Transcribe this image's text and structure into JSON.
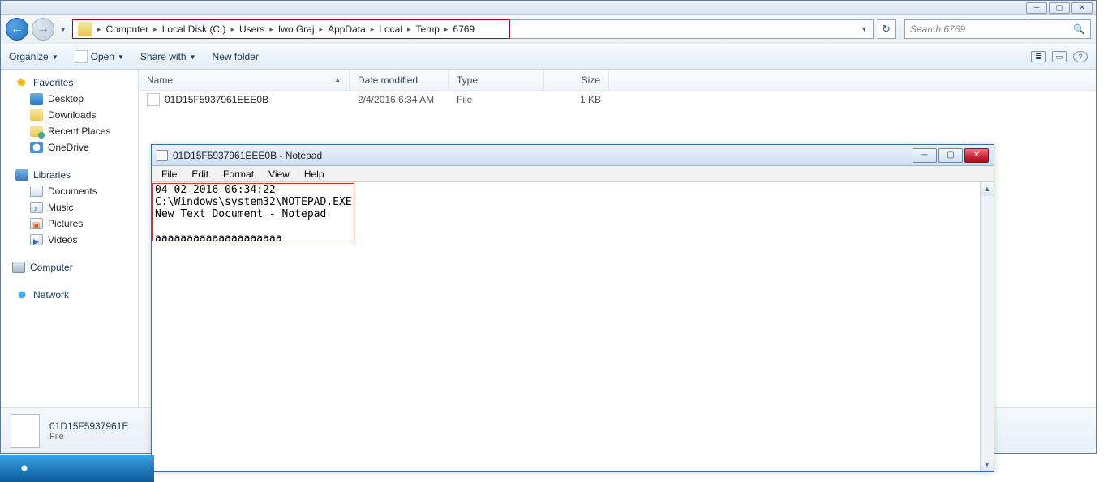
{
  "explorer": {
    "win_controls": {
      "min": "─",
      "max": "▢",
      "close": "✕"
    },
    "nav": {
      "back_glyph": "←",
      "fwd_glyph": "→",
      "drop_glyph": "▾"
    },
    "breadcrumbs": [
      "Computer",
      "Local Disk (C:)",
      "Users",
      "Iwo Graj",
      "AppData",
      "Local",
      "Temp",
      "6769"
    ],
    "refresh_glyph": "↻",
    "search_placeholder": "Search 6769",
    "toolbar": {
      "organize": "Organize",
      "open": "Open",
      "share": "Share with",
      "newfolder": "New folder",
      "view_glyph": "≣",
      "preview_glyph": "▭",
      "help_glyph": "?"
    },
    "sidebar": {
      "favorites": {
        "label": "Favorites",
        "items": [
          "Desktop",
          "Downloads",
          "Recent Places",
          "OneDrive"
        ]
      },
      "libraries": {
        "label": "Libraries",
        "items": [
          "Documents",
          "Music",
          "Pictures",
          "Videos"
        ]
      },
      "computer": "Computer",
      "network": "Network"
    },
    "columns": {
      "name": "Name",
      "date": "Date modified",
      "type": "Type",
      "size": "Size"
    },
    "files": [
      {
        "name": "01D15F5937961EEE0B",
        "date": "2/4/2016 6:34 AM",
        "type": "File",
        "size": "1 KB"
      }
    ],
    "details": {
      "name": "01D15F5937961E",
      "type": "File"
    }
  },
  "notepad": {
    "title": "01D15F5937961EEE0B - Notepad",
    "menu": [
      "File",
      "Edit",
      "Format",
      "View",
      "Help"
    ],
    "content": "04-02-2016 06:34:22\nC:\\Windows\\system32\\NOTEPAD.EXE\nNew Text Document - Notepad\n\naaaaaaaaaaaaaaaaaaaa",
    "win_controls": {
      "min": "─",
      "max": "▢",
      "close": "✕"
    },
    "scroll": {
      "up": "▲",
      "down": "▼"
    }
  }
}
